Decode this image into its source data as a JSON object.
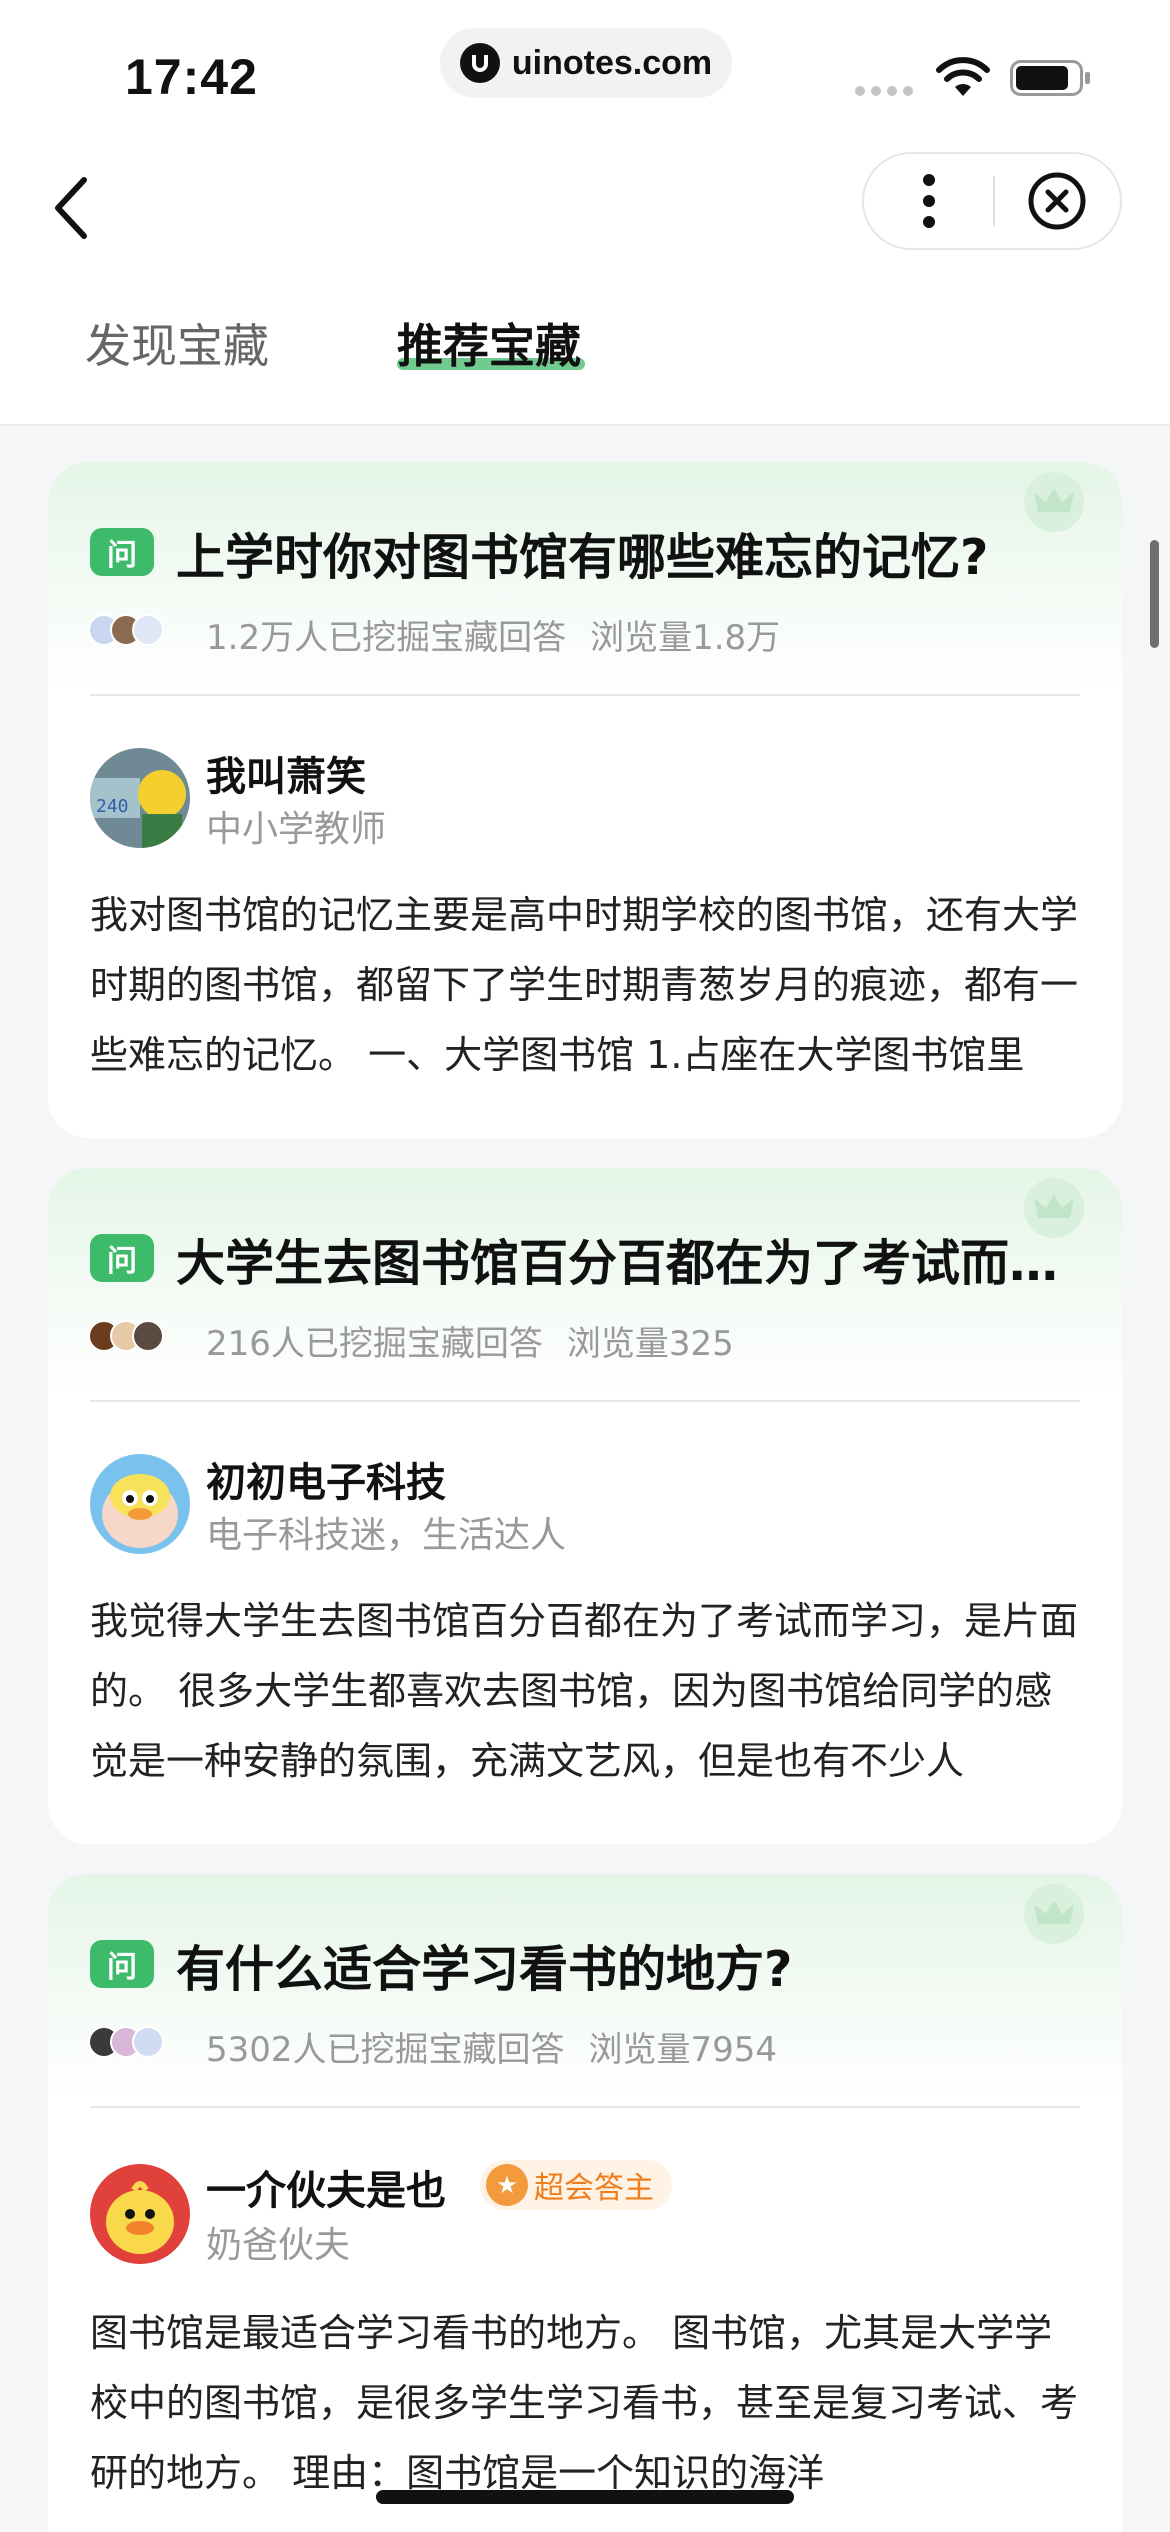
{
  "status_bar": {
    "time": "17:42",
    "url": "uinotes.com"
  },
  "nav": {
    "back_icon": "chevron-left-icon",
    "more_icon": "more-vertical-icon",
    "close_icon": "close-circle-icon"
  },
  "tabs": [
    {
      "label": "发现宝藏",
      "active": false
    },
    {
      "label": "推荐宝藏",
      "active": true
    }
  ],
  "accent_color": "#3dbb6a",
  "cards": [
    {
      "badge": "问",
      "title": "上学时你对图书馆有哪些难忘的记忆?",
      "diggers": "1.2万人已挖掘宝藏回答",
      "views": "浏览量1.8万",
      "author": "我叫萧笑",
      "role": "中小学教师",
      "answer": "我对图书馆的记忆主要是高中时期学校的图书馆，还有大学时期的图书馆，都留下了学生时期青葱岁月的痕迹，都有一些难忘的记忆。 一、大学图书馆 1.占座在大学图书馆里"
    },
    {
      "badge": "问",
      "title": "大学生去图书馆百分百都在为了考试而学习吗？",
      "diggers": "216人已挖掘宝藏回答",
      "views": "浏览量325",
      "author": "初初电子科技",
      "role": "电子科技迷，生活达人",
      "answer": "我觉得大学生去图书馆百分百都在为了考试而学习，是片面的。  很多大学生都喜欢去图书馆，因为图书馆给同学的感觉是一种安静的氛围，充满文艺风，但是也有不少人"
    },
    {
      "badge": "问",
      "title": "有什么适合学习看书的地方?",
      "diggers": "5302人已挖掘宝藏回答",
      "views": "浏览量7954",
      "author": "一介伙夫是也",
      "author_badge": "超会答主",
      "role": "奶爸伙夫",
      "answer": "图书馆是最适合学习看书的地方。 图书馆，尤其是大学学校中的图书馆，是很多学生学习看书，甚至是复习考试、考研的地方。 理由：图书馆是一个知识的海洋"
    }
  ]
}
